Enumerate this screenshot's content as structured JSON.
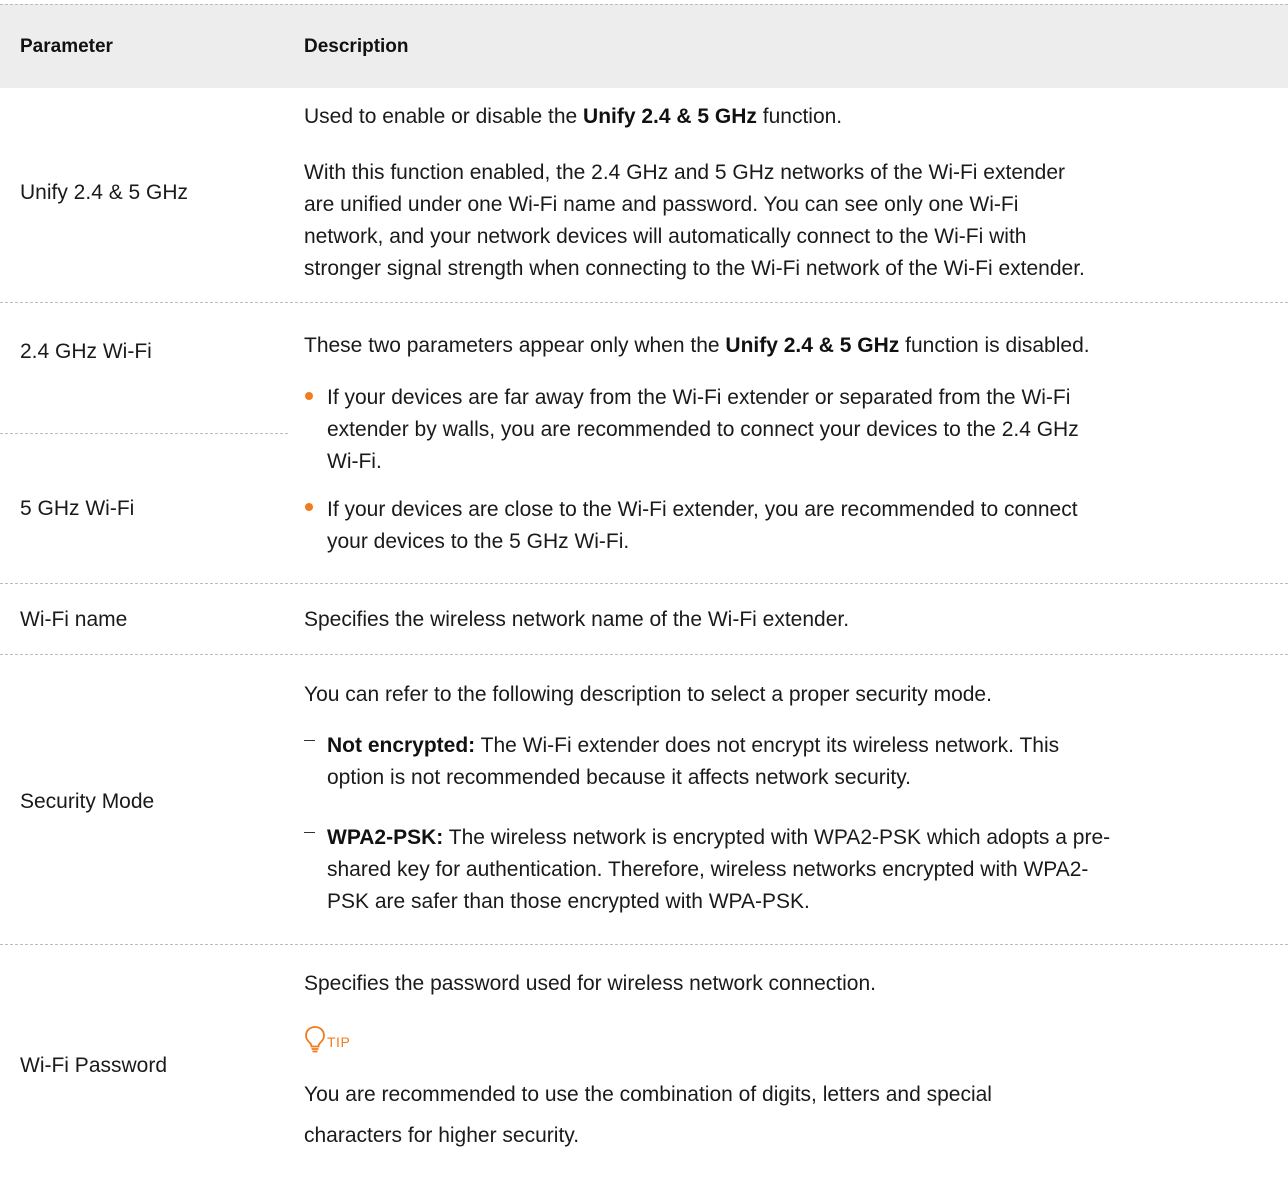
{
  "header": {
    "col_parameter": "Parameter",
    "col_description": "Description"
  },
  "rows": {
    "unify": {
      "label": "Unify 2.4 & 5 GHz",
      "p1": {
        "pre": "Used to enable or disable the ",
        "bold": "Unify 2.4 & 5 GHz",
        "post": " function."
      },
      "p2": [
        "With this function enabled, the 2.4 GHz and 5 GHz networks of the Wi-Fi extender",
        "are unified under one Wi-Fi name and password. You can see only one Wi-Fi",
        "network, and your network devices will automatically connect to the Wi-Fi with",
        "stronger signal strength when connecting to the Wi-Fi network of the Wi-Fi extender."
      ]
    },
    "bands": {
      "label_24": "2.4 GHz Wi-Fi",
      "label_5": "5 GHz Wi-Fi",
      "intro": {
        "pre": "These two parameters appear only when the ",
        "bold": "Unify 2.4 & 5 GHz",
        "post": " function is disabled."
      },
      "bullet1": [
        "If your devices are far away from the Wi-Fi extender or separated from the Wi-Fi",
        "extender by walls, you are recommended to connect your devices to the 2.4 GHz",
        "Wi-Fi."
      ],
      "bullet2": [
        "If your devices are close to the Wi-Fi extender, you are recommended to connect",
        "your devices to the 5 GHz Wi-Fi."
      ]
    },
    "wifi_name": {
      "label": "Wi-Fi name",
      "desc": "Specifies the wireless network name of the Wi-Fi extender."
    },
    "security": {
      "label": "Security Mode",
      "intro": "You can refer to the following description to select a proper security mode.",
      "opt1": {
        "bold": "Not encrypted:",
        "line1": " The Wi-Fi extender does not encrypt its wireless network. This",
        "line2": "option is not recommended because it affects network security."
      },
      "opt2": {
        "bold": "WPA2-PSK:",
        "line1": " The wireless network is encrypted with WPA2-PSK which adopts a pre-",
        "line2": "shared key for authentication. Therefore, wireless networks encrypted with WPA2-",
        "line3": "PSK are safer than those encrypted with WPA-PSK."
      }
    },
    "password": {
      "label": "Wi-Fi Password",
      "desc": "Specifies the password used for wireless network connection.",
      "tip_icon": "lightbulb-icon",
      "tip_label": "TIP",
      "tip_line1": "You are recommended to use the combination of digits, letters and special",
      "tip_line2": "characters for higher security."
    }
  },
  "colors": {
    "accent": "#f07c1e",
    "header_bg": "#ededed",
    "separator": "#bdbdbd"
  }
}
